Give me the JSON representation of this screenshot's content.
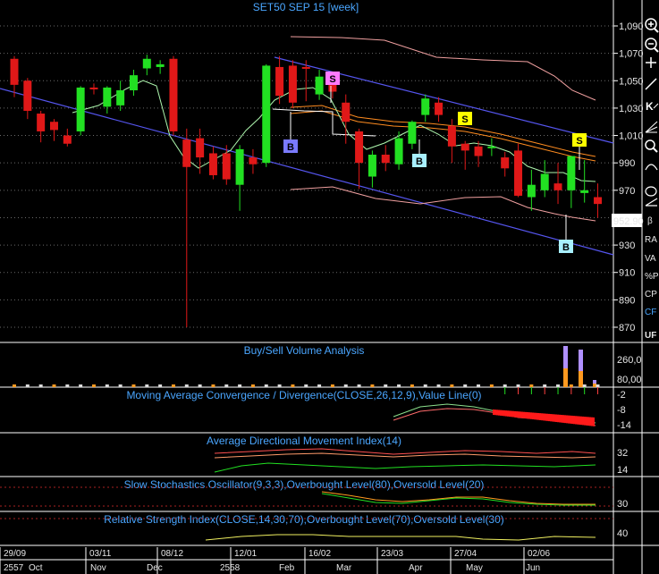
{
  "header": {
    "title": "SET50 SEP 15  [week]"
  },
  "panes": {
    "volume_title": "Buy/Sell Volume Analysis",
    "macd_title": "Moving Average Convergence / Divergence(CLOSE,26,12,9),Value Line(0)",
    "adx_title": "Average Directional Movement Index(14)",
    "stoch_title": "Slow Stochastics Oscillator(9,3,3),Overbought Level(80),Oversold Level(20)",
    "rsi_title": "Relative Strength Index(CLOSE,14,30,70),Overbought Level(70),Oversold Level(30)"
  },
  "price_axis": {
    "ticks": [
      "1,090",
      "1,070",
      "1,050",
      "1,030",
      "1,010",
      "990",
      "970",
      "950",
      "930",
      "910",
      "890",
      "870"
    ],
    "last_price": "952.90"
  },
  "volume_axis": {
    "ticks": [
      "260,0",
      "80,00"
    ]
  },
  "macd_axis": {
    "ticks": [
      "-2",
      "-8",
      "-14"
    ]
  },
  "adx_axis": {
    "ticks": [
      "32",
      "14"
    ]
  },
  "stoch_axis": {
    "ticks": [
      "30"
    ]
  },
  "rsi_axis": {
    "ticks": [
      "40"
    ]
  },
  "date_axis": {
    "top": [
      "29/09",
      "03/11",
      "08/12",
      "12/01",
      "16/02",
      "23/03",
      "27/04",
      "02/06"
    ],
    "bottom": [
      "2557",
      "Oct",
      "Nov",
      "Dec",
      "2558",
      "Feb",
      "Mar",
      "Apr",
      "May",
      "Jun"
    ]
  },
  "side_toolbar": {
    "items": [
      "β",
      "RA",
      "VA",
      "%P",
      "CP",
      "CF",
      "UF"
    ]
  },
  "signals": [
    {
      "label": "B"
    },
    {
      "label": "S"
    },
    {
      "label": "B"
    },
    {
      "label": "S"
    },
    {
      "label": "S"
    },
    {
      "label": "B"
    }
  ],
  "colors": {
    "bull": "#22e022",
    "bear": "#e01818",
    "channel": "#5555ee",
    "title": "#4aa6ff",
    "buy_label": "#7a7aff",
    "sell_label": "#ff7aff",
    "sell_yellow": "#ffff00",
    "buy_cyan": "#a8f0ff"
  },
  "chart_data": {
    "type": "candlestick",
    "title": "SET50 SEP 15  [week]",
    "y_ticks": [
      1090,
      1070,
      1050,
      1030,
      1010,
      990,
      970,
      950,
      930,
      910,
      890,
      870
    ],
    "last": 952.9,
    "ohlc": [
      [
        1066,
        1068,
        1038,
        1047
      ],
      [
        1050,
        1052,
        1022,
        1028
      ],
      [
        1026,
        1028,
        1005,
        1013
      ],
      [
        1020,
        1022,
        1006,
        1014
      ],
      [
        1010,
        1015,
        1002,
        1004
      ],
      [
        1013,
        1046,
        1010,
        1045
      ],
      [
        1045,
        1048,
        1040,
        1044
      ],
      [
        1031,
        1046,
        1026,
        1045
      ],
      [
        1032,
        1050,
        1028,
        1043
      ],
      [
        1043,
        1058,
        1039,
        1054
      ],
      [
        1059,
        1069,
        1054,
        1066
      ],
      [
        1060,
        1065,
        1055,
        1062
      ],
      [
        1066,
        1068,
        1010,
        1013
      ],
      [
        1007,
        1015,
        870,
        987
      ],
      [
        1008,
        1015,
        982,
        994
      ],
      [
        997,
        1002,
        978,
        981
      ],
      [
        997,
        1003,
        974,
        978
      ],
      [
        974,
        1003,
        955,
        1000
      ],
      [
        994,
        1000,
        982,
        989
      ],
      [
        990,
        1062,
        987,
        1061
      ],
      [
        1060,
        1068,
        1033,
        1039
      ],
      [
        1061,
        1065,
        1030,
        1034
      ],
      [
        1060,
        1065,
        1035,
        1059
      ],
      [
        1040,
        1058,
        1036,
        1053
      ],
      [
        1050,
        1056,
        1037,
        1042
      ],
      [
        1034,
        1040,
        1004,
        1020
      ],
      [
        1013,
        1015,
        971,
        990
      ],
      [
        980,
        999,
        972,
        996
      ],
      [
        996,
        1003,
        984,
        990
      ],
      [
        989,
        1013,
        985,
        1008
      ],
      [
        1004,
        1021,
        1000,
        1020
      ],
      [
        1025,
        1040,
        1020,
        1037
      ],
      [
        1034,
        1038,
        1020,
        1025
      ],
      [
        1017,
        1022,
        990,
        1002
      ],
      [
        1004,
        1006,
        985,
        999
      ],
      [
        1002,
        1006,
        987,
        995
      ],
      [
        1002,
        1008,
        995,
        1002
      ],
      [
        994,
        998,
        980,
        986
      ],
      [
        999,
        1004,
        965,
        966
      ],
      [
        965,
        985,
        955,
        974
      ],
      [
        970,
        992,
        965,
        982
      ],
      [
        975,
        990,
        960,
        970
      ],
      [
        970,
        991,
        957,
        995
      ],
      [
        968,
        992,
        961,
        970
      ],
      [
        965,
        975,
        950,
        960
      ]
    ]
  }
}
